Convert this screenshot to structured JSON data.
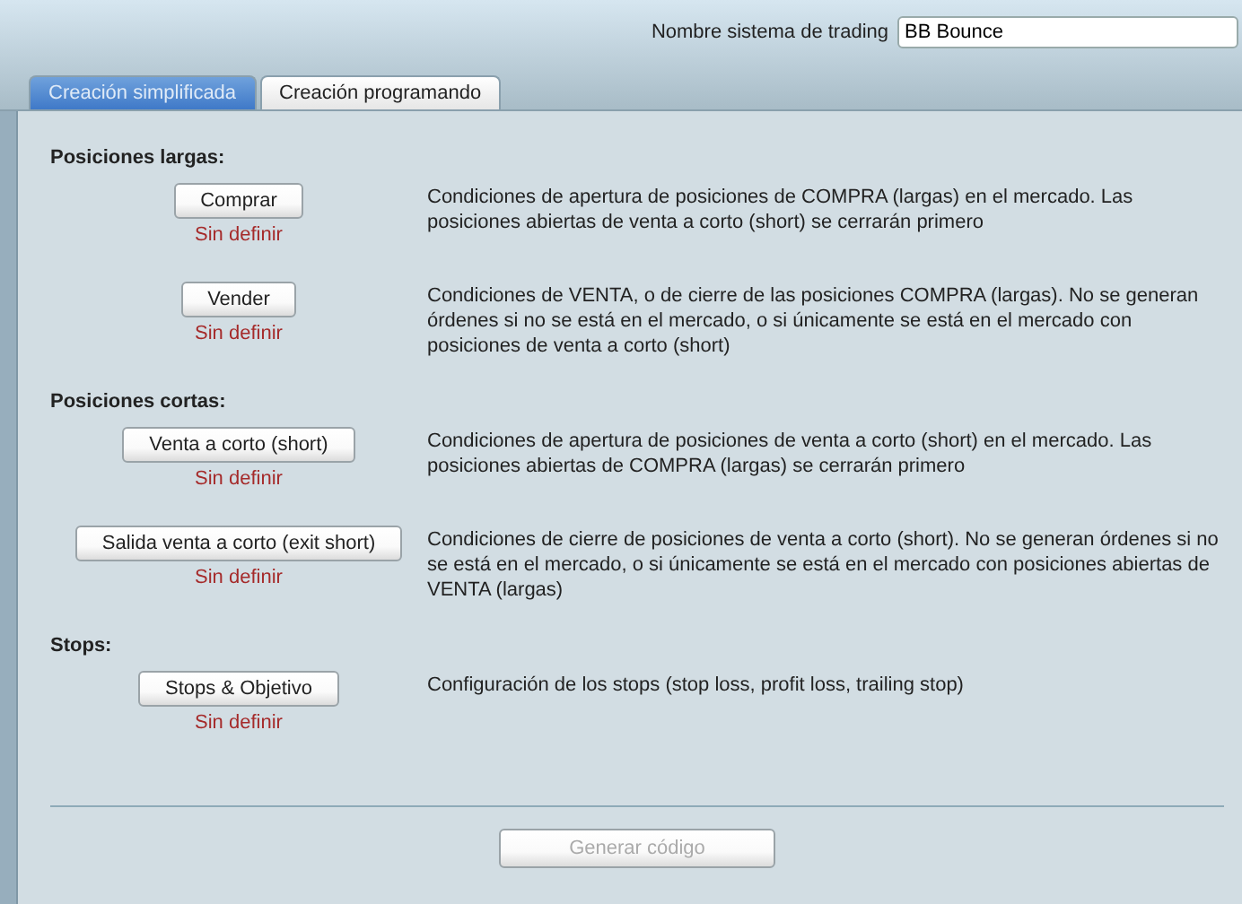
{
  "header": {
    "name_label": "Nombre sistema de trading",
    "name_value": "BB Bounce"
  },
  "tabs": [
    {
      "label": "Creación simplificada",
      "selected": true
    },
    {
      "label": "Creación programando",
      "selected": false
    }
  ],
  "sections": [
    {
      "heading": "Posiciones largas:",
      "items": [
        {
          "button": "Comprar",
          "status": "Sin definir",
          "description": "Condiciones de apertura de posiciones de COMPRA (largas) en el mercado. Las posiciones abiertas de venta a corto (short) se cerrarán primero"
        },
        {
          "button": "Vender",
          "status": "Sin definir",
          "description": "Condiciones de VENTA, o de cierre de las posiciones COMPRA (largas). No se generan órdenes si no se está en el mercado, o si únicamente se está en el mercado con posiciones de venta a corto (short)"
        }
      ]
    },
    {
      "heading": "Posiciones cortas:",
      "items": [
        {
          "button": "Venta a corto (short)",
          "status": "Sin definir",
          "description": "Condiciones de apertura de posiciones de venta a corto (short) en el mercado. Las posiciones abiertas de COMPRA (largas) se cerrarán primero"
        },
        {
          "button": "Salida venta a corto (exit short)",
          "status": "Sin definir",
          "description": "Condiciones de cierre de posiciones de venta a corto (short). No se generan órdenes si no se está en el mercado, o si únicamente se está en el mercado con posiciones abiertas de VENTA (largas)"
        }
      ]
    },
    {
      "heading": "Stops:",
      "items": [
        {
          "button": "Stops & Objetivo",
          "status": "Sin definir",
          "description": "Configuración de los stops (stop loss, profit loss, trailing stop)"
        }
      ]
    }
  ],
  "generate_button": {
    "label": "Generar código",
    "disabled": true
  }
}
